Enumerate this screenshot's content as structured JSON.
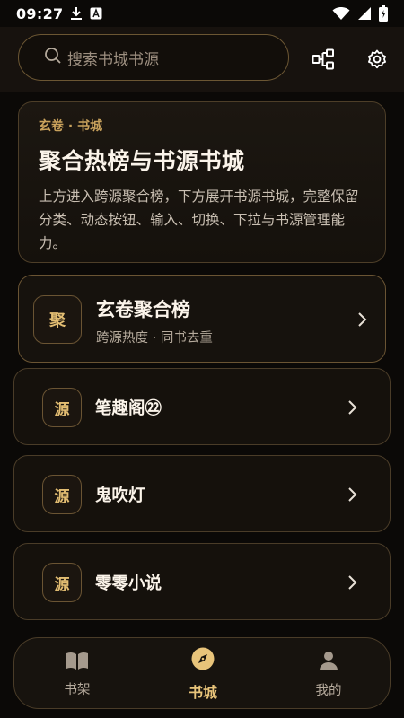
{
  "status_bar": {
    "time": "09:27",
    "left_icons": [
      "download-icon",
      "font-a-icon"
    ],
    "right_icons": [
      "wifi-icon",
      "signal-icon",
      "battery-icon"
    ]
  },
  "header": {
    "search_placeholder": "搜索书城书源",
    "icons": [
      "flow-icon",
      "settings-icon"
    ]
  },
  "hero": {
    "tag": "玄卷 · 书城",
    "title": "聚合热榜与书源书城",
    "description": "上方进入跨源聚合榜，下方展开书源书城，完整保留分类、动态按钮、输入、切换、下拉与书源管理能力。"
  },
  "aggregate": {
    "badge": "聚",
    "title": "玄卷聚合榜",
    "subtitle": "跨源热度 · 同书去重"
  },
  "sources": [
    {
      "badge": "源",
      "title": "笔趣阁㉒"
    },
    {
      "badge": "源",
      "title": "鬼吹灯"
    },
    {
      "badge": "源",
      "title": "零零小说"
    }
  ],
  "bottom_nav": {
    "items": [
      {
        "label": "书架",
        "icon": "book-open-icon",
        "active": false
      },
      {
        "label": "书城",
        "icon": "compass-icon",
        "active": true
      },
      {
        "label": "我的",
        "icon": "person-icon",
        "active": false
      }
    ]
  },
  "colors": {
    "accent": "#e2bd72",
    "background": "#0b0907",
    "card_border": "#6a5433"
  }
}
